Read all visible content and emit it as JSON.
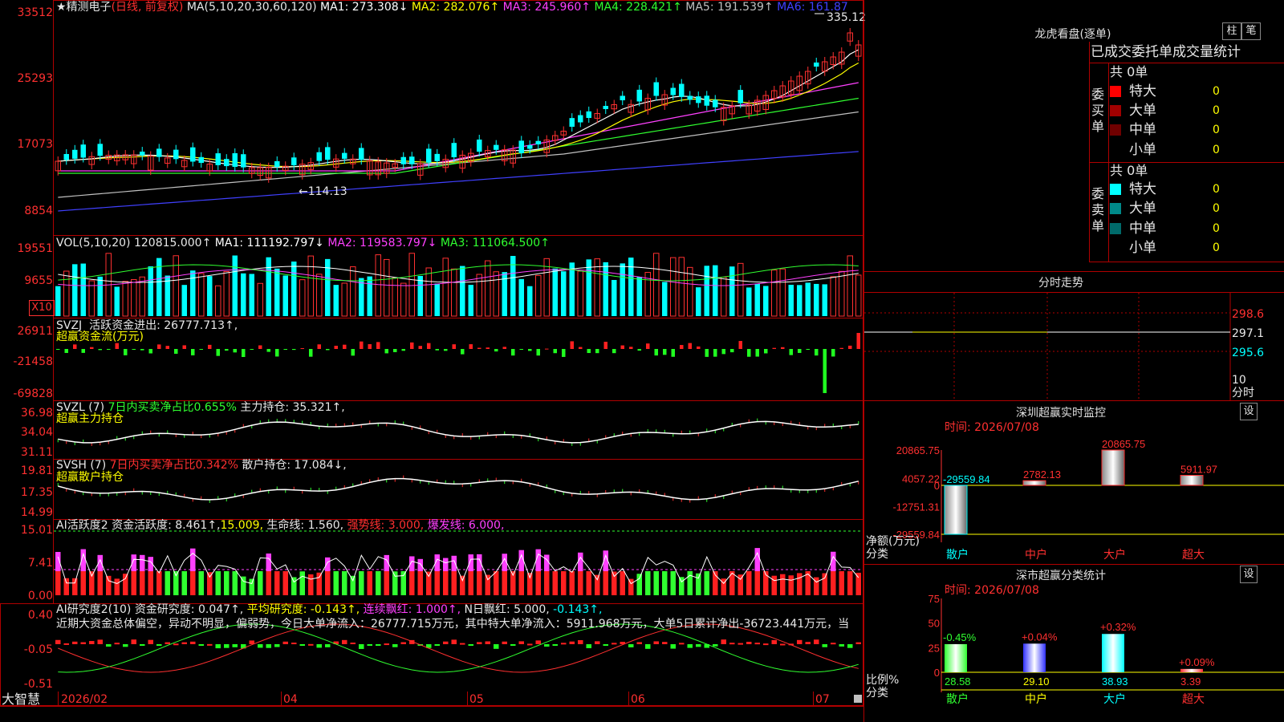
{
  "stock": {
    "star": "★",
    "name": "精测电子",
    "mode": "(日线, 前复权)"
  },
  "main": {
    "ma_label": "MA(5,10,20,30,60,120)",
    "ma": [
      {
        "label": "MA1:",
        "value": "273.308↓",
        "color": "#ffffff"
      },
      {
        "label": "MA2:",
        "value": "282.076↑",
        "color": "#ffff00"
      },
      {
        "label": "MA3:",
        "value": "245.960↑",
        "color": "#ff40ff"
      },
      {
        "label": "MA4:",
        "value": "228.421↑",
        "color": "#30ff30"
      },
      {
        "label": "MA5:",
        "value": "191.539↑",
        "color": "#c0c0c0"
      },
      {
        "label": "MA6:",
        "value": "161.87",
        "color": "#4040ff"
      }
    ],
    "high_label": "335.12",
    "low_label": "←114.13",
    "axis": [
      "33512",
      "25293",
      "17073",
      "8854"
    ]
  },
  "vol": {
    "label": "VOL(5,10,20)",
    "value": "120815.000↑",
    "ma": [
      {
        "label": "MA1:",
        "value": "111192.797↓",
        "color": "#ffffff"
      },
      {
        "label": "MA2:",
        "value": "119583.797↓",
        "color": "#ff40ff"
      },
      {
        "label": "MA3:",
        "value": "111064.500↑",
        "color": "#30ff30"
      }
    ],
    "axis": [
      "19551",
      "9655"
    ],
    "unit": "X10"
  },
  "svzj": {
    "label": "SVZJ",
    "desc": "活跃资金进出:",
    "value": "26777.713↑,",
    "sub": "超赢资金流(万元)",
    "axis": [
      "26911",
      "-21458",
      "-69828"
    ]
  },
  "svzl": {
    "label": "SVZL (7)",
    "desc": "7日内买卖净占比0.655%",
    "main": "主力持仓:",
    "value": "35.321↑,",
    "sub": "超赢主力持仓",
    "axis": [
      "36.98",
      "34.04",
      "31.11"
    ]
  },
  "svsh": {
    "label": "SVSH (7)",
    "desc": "7日内买卖净占比0.342%",
    "main": "散户持仓:",
    "value": "17.084↓,",
    "sub": "超赢散户持仓",
    "axis": [
      "19.81",
      "17.35",
      "14.99"
    ]
  },
  "ai2": {
    "label": "AI活跃度2",
    "desc": "资金活跃度:",
    "value": "8.461↑,",
    "v2": "15.009,",
    "v3label": "生命线:",
    "v3": "1.560,",
    "v4": "强势线: 3.000,",
    "v5": "爆发线: 6.000,",
    "axis": [
      "15.01",
      "7.41",
      "0.00"
    ]
  },
  "ai_res": {
    "label": "AI研究度2(10)",
    "desc": "资金研究度:",
    "value": "0.047↑,",
    "avg": "平均研究度: -0.143↑,",
    "red": "连续飘红: 1.000↑,",
    "nred": "N日飘红: 5.000,",
    "last": "-0.143↑,",
    "comment": "近期大资金总体偏空，异动不明显，偏弱势，今日大单净流入：26777.715万元，其中特大单净流入：5911.968万元，大单5日累计净出-36723.441万元，当",
    "axis": [
      "0.40",
      "-0.05",
      "-0.51"
    ]
  },
  "dates": {
    "brand": "大智慧",
    "labels": [
      "2026/02",
      "04",
      "05",
      "06",
      "07"
    ]
  },
  "lhb": {
    "title": "龙虎看盘(逐单)",
    "btn1": "柱",
    "btn2": "笔",
    "header": "已成交委托单成交量统计",
    "buy_side": "委买单",
    "sell_side": "委卖单",
    "buy_total": "共 0单",
    "sell_total": "共 0单",
    "buy": [
      {
        "label": "特大",
        "value": "0",
        "color": "#ff0000"
      },
      {
        "label": "大单",
        "value": "0",
        "color": "#a00000"
      },
      {
        "label": "中单",
        "value": "0",
        "color": "#700000"
      },
      {
        "label": "小单",
        "value": "0",
        "color": "#000000"
      }
    ],
    "sell": [
      {
        "label": "特大",
        "value": "0",
        "color": "#00ffff"
      },
      {
        "label": "大单",
        "value": "0",
        "color": "#008a8a"
      },
      {
        "label": "中单",
        "value": "0",
        "color": "#006a6a"
      },
      {
        "label": "小单",
        "value": "0",
        "color": "#000000"
      }
    ]
  },
  "fenshi": {
    "title": "分时走势",
    "axis": [
      "298.6",
      "297.1",
      "295.6"
    ],
    "foot1": "10",
    "foot2": "分时"
  },
  "sz_monitor": {
    "title": "深圳超赢实时监控",
    "btn": "设",
    "time": "时间: 2026/07/08",
    "axis": [
      "20865.75",
      "4057.22",
      "0",
      "-12751.31",
      "-29559.84"
    ],
    "ylabel": "净额(万元)",
    "xlabel": "分类",
    "bars": [
      {
        "cat": "散户",
        "value": "-29559.84"
      },
      {
        "cat": "中户",
        "value": "2782.13"
      },
      {
        "cat": "大户",
        "value": "20865.75"
      },
      {
        "cat": "超大",
        "value": "5911.97"
      }
    ]
  },
  "sz_stats": {
    "title": "深市超赢分类统计",
    "btn": "设",
    "time": "时间: 2026/07/08",
    "axis": [
      "75",
      "50",
      "25",
      "0"
    ],
    "ylabel": "比例%",
    "xlabel": "分类",
    "bars": [
      {
        "cat": "散户",
        "pct": "28.58",
        "chg": "-0.45%"
      },
      {
        "cat": "中户",
        "pct": "29.10",
        "chg": "+0.04%"
      },
      {
        "cat": "大户",
        "pct": "38.93",
        "chg": "+0.32%"
      },
      {
        "cat": "超大",
        "pct": "3.39",
        "chg": "+0.09%"
      }
    ]
  }
}
